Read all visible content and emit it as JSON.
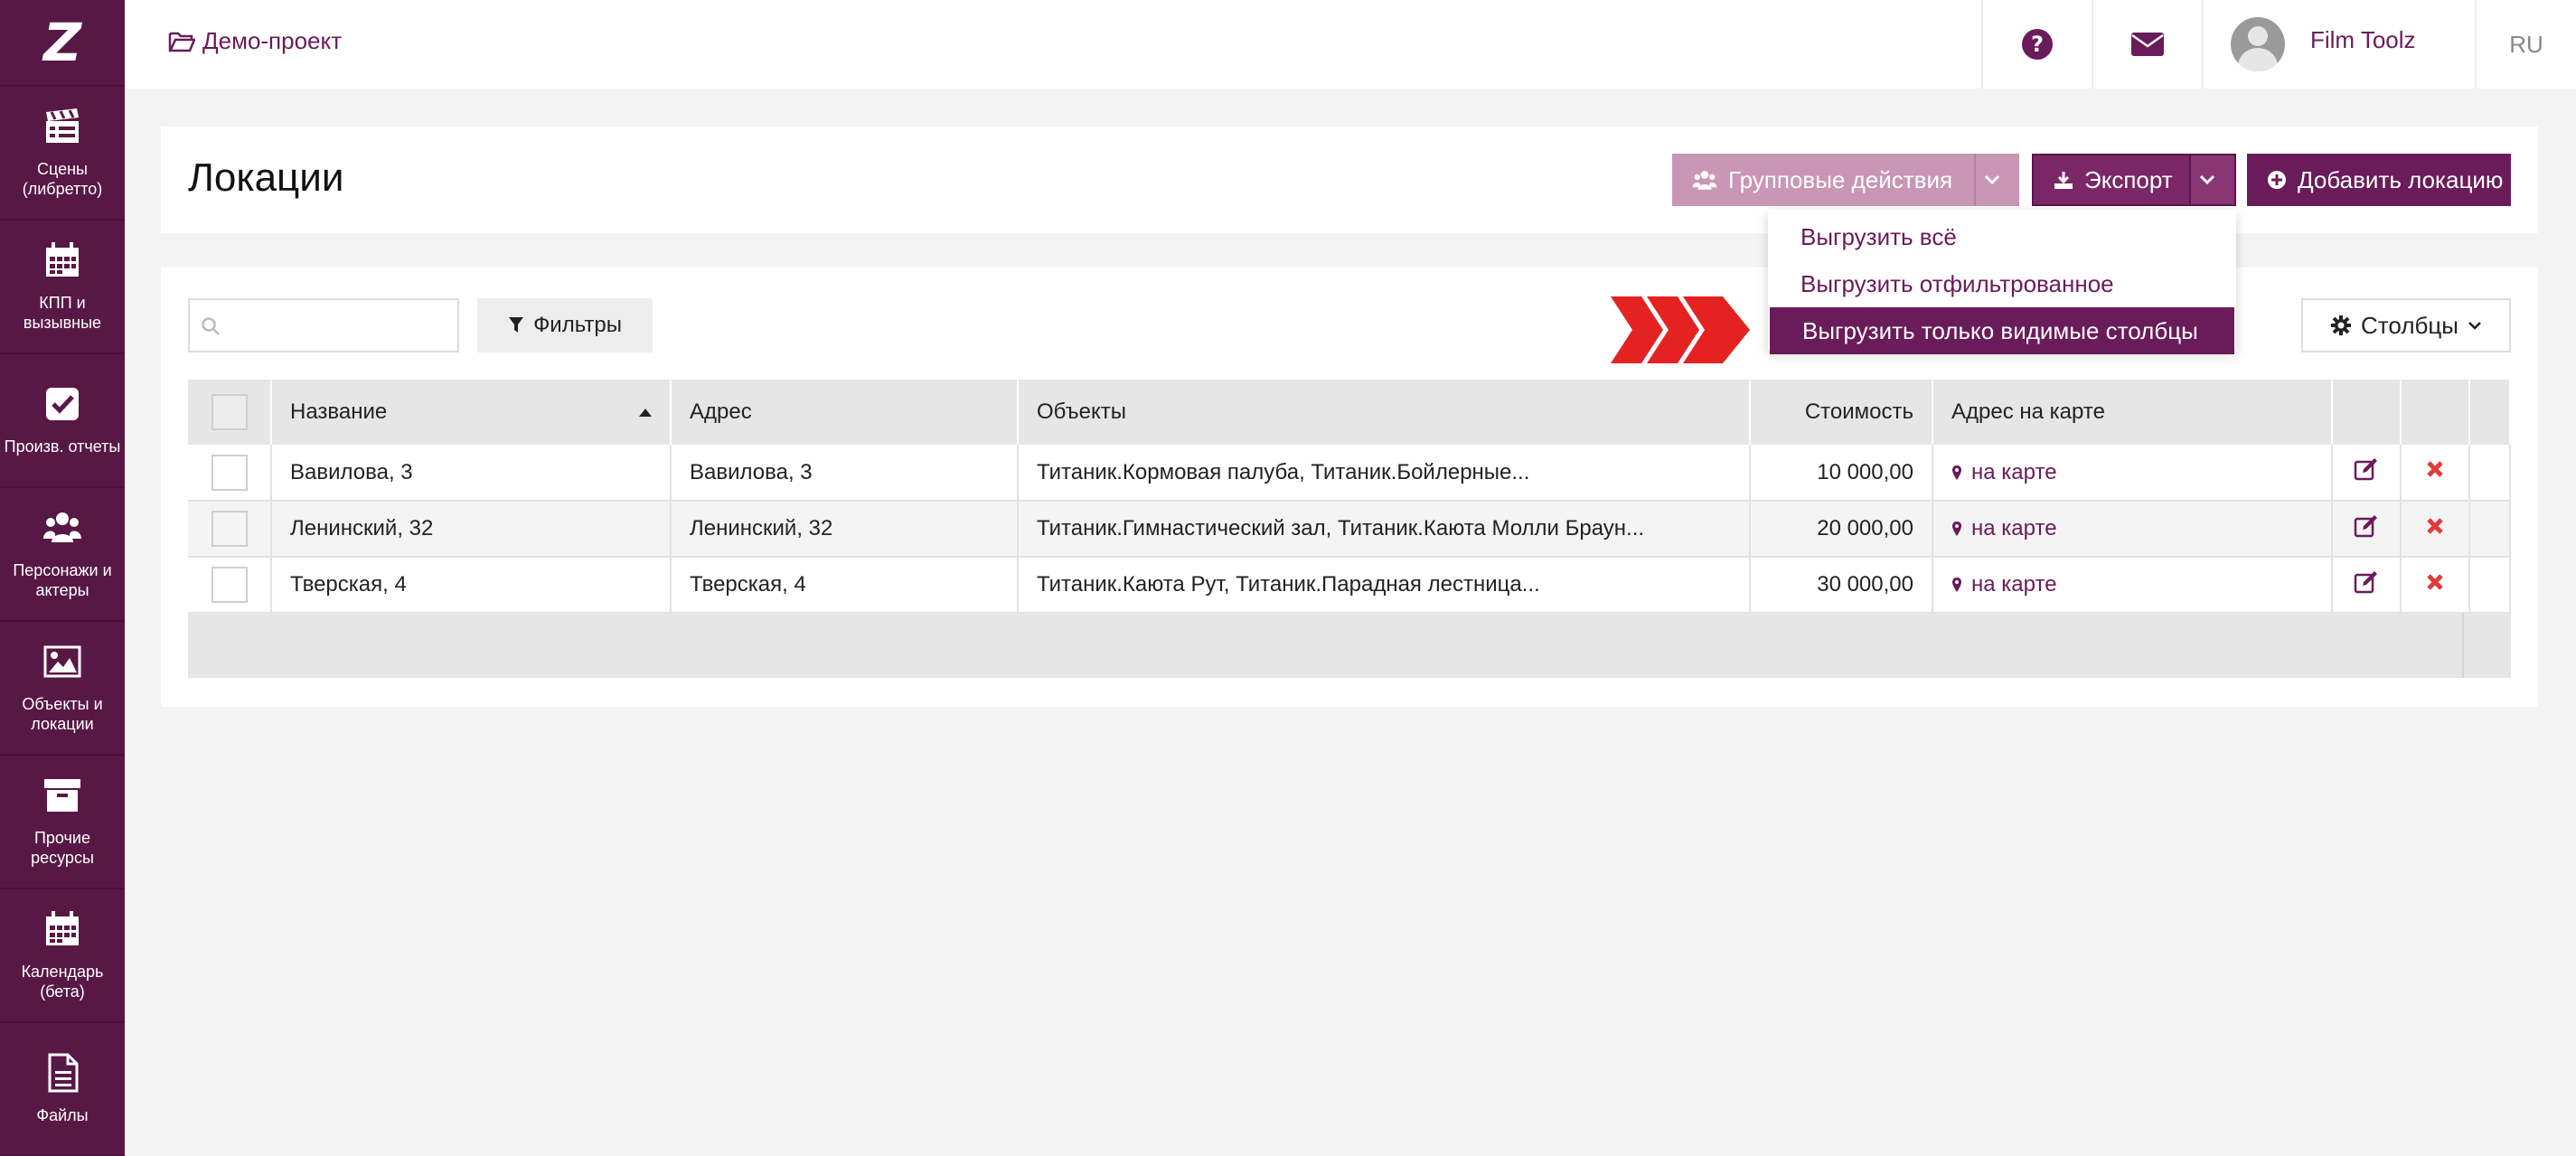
{
  "app": {
    "logo_text": "Z",
    "accent_color": "#6a1b5a",
    "sidebar_color": "#581845"
  },
  "sidebar": {
    "items": [
      {
        "label": "Сцены\n(либретто)",
        "icon": "clapperboard-icon"
      },
      {
        "label": "КПП и\nвызывные",
        "icon": "calendar-icon"
      },
      {
        "label": "Произв. отчеты",
        "icon": "checkbox-icon"
      },
      {
        "label": "Персонажи и\nактеры",
        "icon": "users-icon"
      },
      {
        "label": "Объекты и\nлокации",
        "icon": "image-icon"
      },
      {
        "label": "Прочие\nресурсы",
        "icon": "archive-icon"
      },
      {
        "label": "Календарь\n(бета)",
        "icon": "calendar-icon"
      },
      {
        "label": "Файлы",
        "icon": "file-icon"
      }
    ]
  },
  "header": {
    "project_name": "Демо-проект",
    "user_name": "Film Toolz",
    "language": "RU"
  },
  "page": {
    "title": "Локации",
    "group_actions_label": "Групповые действия",
    "export_label": "Экспорт",
    "add_location_label": "Добавить локацию"
  },
  "export_menu": {
    "items": [
      {
        "label": "Выгрузить всё",
        "active": false
      },
      {
        "label": "Выгрузить отфильтрованное",
        "active": false
      },
      {
        "label": "Выгрузить только видимые столбцы",
        "active": true
      }
    ]
  },
  "toolbar": {
    "search_value": "",
    "filters_label": "Фильтры",
    "columns_label": "Столбцы"
  },
  "table": {
    "columns": [
      "Название",
      "Адрес",
      "Объекты",
      "Стоимость",
      "Адрес на карте"
    ],
    "rows": [
      {
        "name": "Вавилова, 3",
        "address": "Вавилова, 3",
        "objects": "Титаник.Кормовая палуба, Титаник.Бойлерные...",
        "cost": "10 000,00",
        "map": "на карте"
      },
      {
        "name": "Ленинский, 32",
        "address": "Ленинский, 32",
        "objects": "Титаник.Гимнастический зал, Титаник.Каюта Молли Браун...",
        "cost": "20 000,00",
        "map": "на карте"
      },
      {
        "name": "Тверская, 4",
        "address": "Тверская, 4",
        "objects": "Титаник.Каюта Рут, Титаник.Парадная лестница...",
        "cost": "30 000,00",
        "map": "на карте"
      }
    ]
  }
}
